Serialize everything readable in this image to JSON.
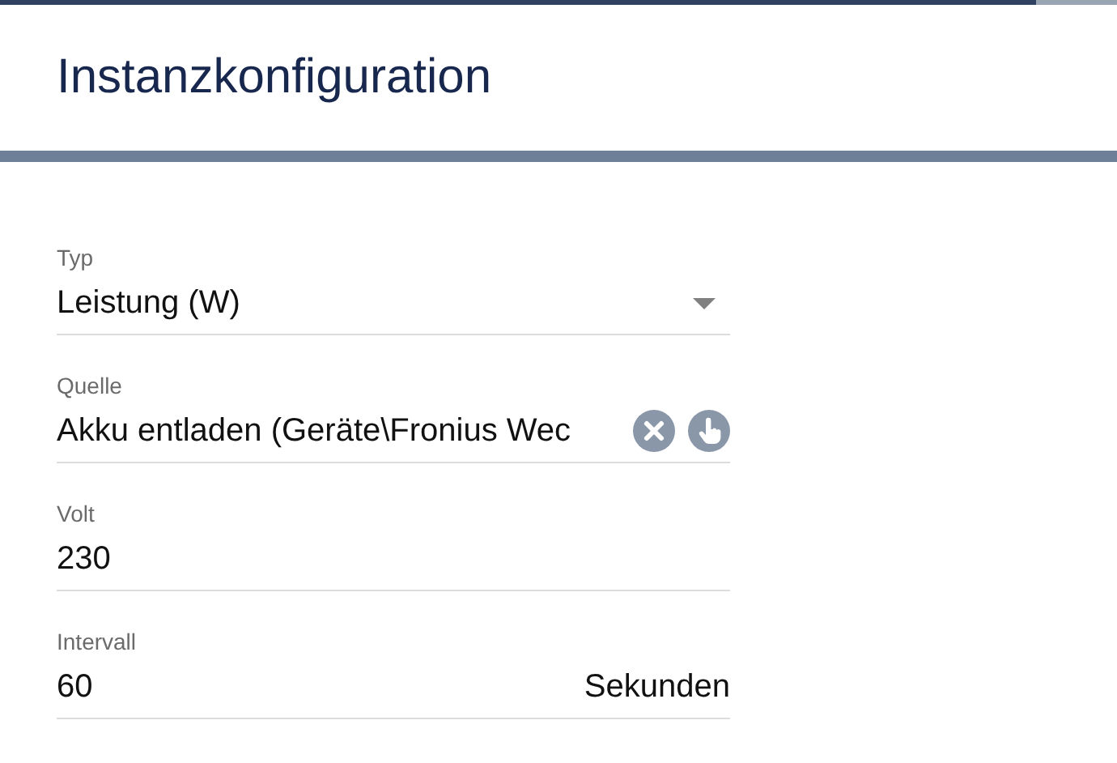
{
  "header": {
    "title": "Instanzkonfiguration"
  },
  "fields": [
    {
      "kind": "select",
      "label": "Typ",
      "value": "Leistung (W)"
    },
    {
      "kind": "picker",
      "label": "Quelle",
      "value": "Akku entladen (Geräte\\Fronius Wec"
    },
    {
      "kind": "text",
      "label": "Volt",
      "value": "230"
    },
    {
      "kind": "suffix",
      "label": "Intervall",
      "value": "60",
      "suffix": "Sekunden"
    }
  ]
}
